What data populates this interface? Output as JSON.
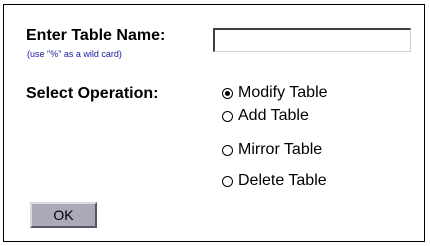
{
  "form": {
    "table_name_label": "Enter Table Name:",
    "wildcard_hint": "(use \"%\" as a wild card)",
    "table_name_value": "",
    "table_name_placeholder": "",
    "operation_label": "Select Operation:",
    "operations": [
      {
        "label": "Modify Table",
        "selected": true
      },
      {
        "label": "Add Table",
        "selected": false
      },
      {
        "label": "Mirror Table",
        "selected": false
      },
      {
        "label": "Delete Table",
        "selected": false
      }
    ],
    "ok_label": "OK"
  },
  "colors": {
    "hint_text": "#1a1aa0",
    "button_face": "#a9a9b8",
    "frame_border": "#000000"
  }
}
